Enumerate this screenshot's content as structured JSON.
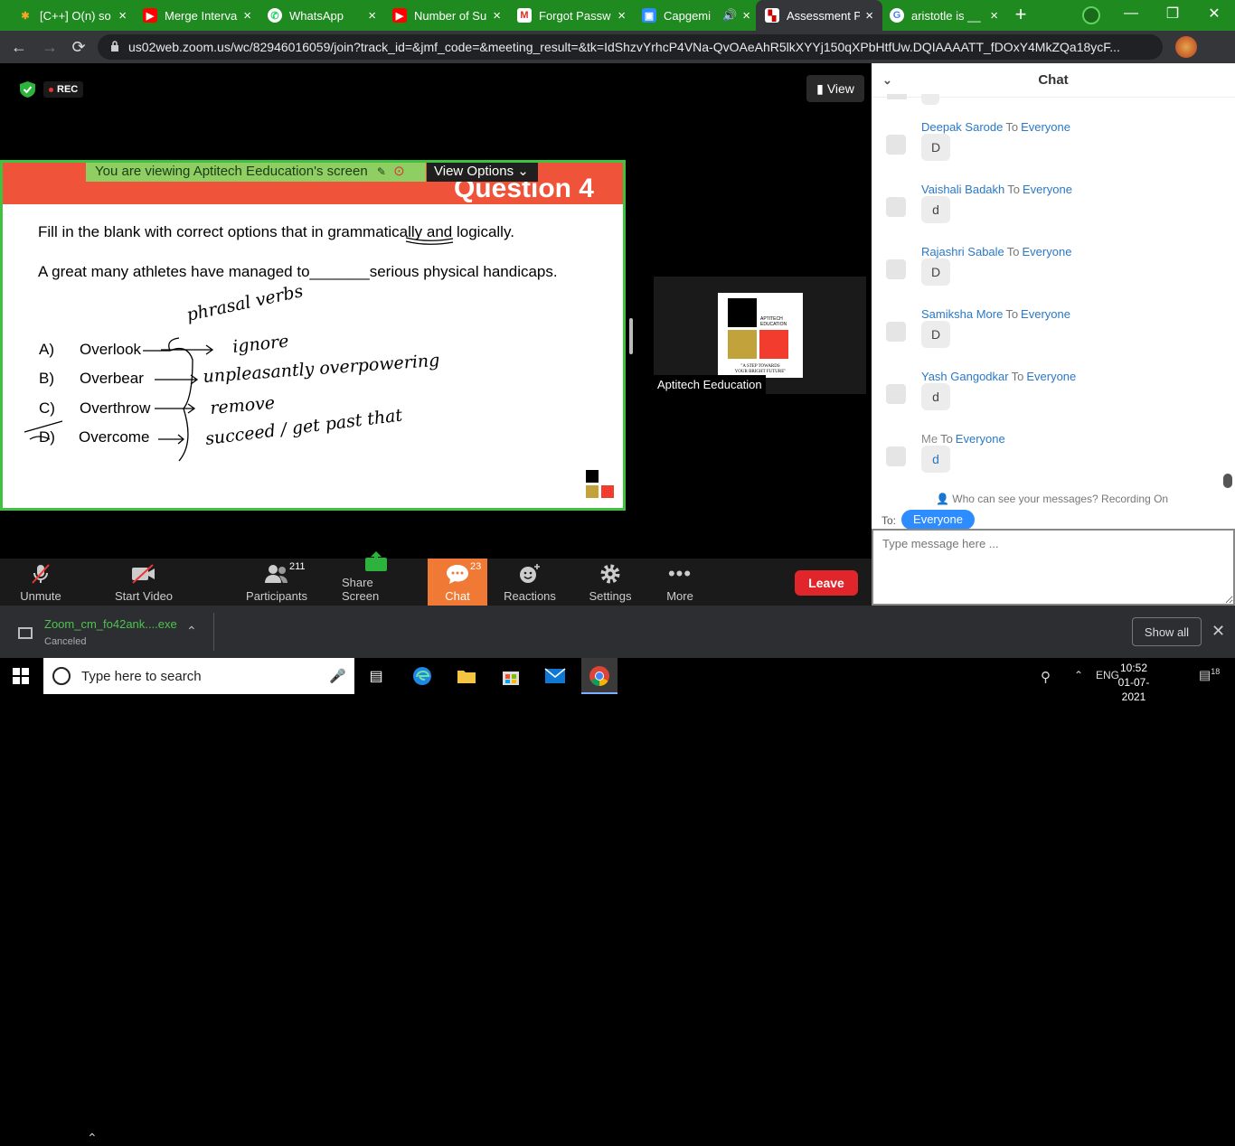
{
  "browser": {
    "tabs": [
      {
        "label": "[C++] O(n) so",
        "favicon": "flame"
      },
      {
        "label": "Merge Interva",
        "favicon": "youtube"
      },
      {
        "label": "WhatsApp",
        "favicon": "whatsapp"
      },
      {
        "label": "Number of Su",
        "favicon": "youtube"
      },
      {
        "label": "Forgot Passw",
        "favicon": "gmail"
      },
      {
        "label": "Capgemi",
        "favicon": "zoom"
      },
      {
        "label": "Assessment P",
        "favicon": "assessment"
      },
      {
        "label": "aristotle is __",
        "favicon": "google"
      }
    ],
    "url": "us02web.zoom.us/wc/82946016059/join?track_id=&jmf_code=&meeting_result=&tk=IdShzvYrhcP4VNa-QvOAeAhR5lkXYYj150qXPbHtfUw.DQIAAAATT_fDOxY4MkZQa18ycF..."
  },
  "zoom": {
    "rec_label": "REC",
    "view_label": "View",
    "viewing_banner": "You are viewing Aptitech Eeducation's screen",
    "view_options": "View Options",
    "slide": {
      "title": "Question 4",
      "instruction": "Fill in the blank  with correct options that in grammatically and logically.",
      "sentence": "A great many athletes have managed to_______serious physical  handicaps.",
      "options": [
        {
          "letter": "A)",
          "word": "Overlook"
        },
        {
          "letter": "B)",
          "word": "Overbear"
        },
        {
          "letter": "C)",
          "word": "Overthrow"
        },
        {
          "letter": "D)",
          "word": "Overcome"
        }
      ],
      "handwriting": {
        "phrasal": "phrasal verbs",
        "a": "ignore",
        "b": "unpleasantly overpowering",
        "c": "remove",
        "d": "succeed / get past that"
      }
    },
    "participant_tile": {
      "name": "Aptitech Eeducation",
      "logo_text": [
        "APTITECH",
        "EDUCATION"
      ],
      "tagline": [
        "\"A STEP TOWARDS",
        "YOUR BRIGHT FUTURE\""
      ]
    },
    "toolbar": {
      "unmute": "Unmute",
      "start_video": "Start Video",
      "participants": "Participants",
      "participants_count": "211",
      "share_screen": "Share Screen",
      "chat": "Chat",
      "chat_count": "23",
      "reactions": "Reactions",
      "settings": "Settings",
      "more": "More",
      "leave": "Leave"
    }
  },
  "chat": {
    "title": "Chat",
    "messages": [
      {
        "sender": "Deepak Sarode",
        "to": "To",
        "recipient": "Everyone",
        "text": "D"
      },
      {
        "sender": "Vaishali Badakh",
        "to": "To",
        "recipient": "Everyone",
        "text": "d"
      },
      {
        "sender": "Rajashri Sabale",
        "to": "To",
        "recipient": "Everyone",
        "text": "D"
      },
      {
        "sender": "Samiksha More",
        "to": "To",
        "recipient": "Everyone",
        "text": "D"
      },
      {
        "sender": "Yash Gangodkar",
        "to": "To",
        "recipient": "Everyone",
        "text": "d"
      },
      {
        "sender": "Me",
        "to": "To",
        "recipient": "Everyone",
        "text": "d"
      }
    ],
    "privacy_note": "Who can see your messages? Recording On",
    "to_label": "To:",
    "to_value": "Everyone",
    "input_placeholder": "Type message here ..."
  },
  "downloads": {
    "file": "Zoom_cm_fo42ank....exe",
    "status": "Canceled",
    "show_all": "Show all"
  },
  "taskbar": {
    "search_placeholder": "Type here to search",
    "language": "ENG",
    "time": "10:52",
    "date": "01-07-2021",
    "notifications": "18"
  },
  "colors": {
    "browser_green": "#1f8a1f",
    "slide_header": "#ef5339",
    "share_border": "#3fc23f",
    "chat_accent": "#2d8cff",
    "leave": "#e0262b",
    "chat_active": "#f07a35"
  }
}
